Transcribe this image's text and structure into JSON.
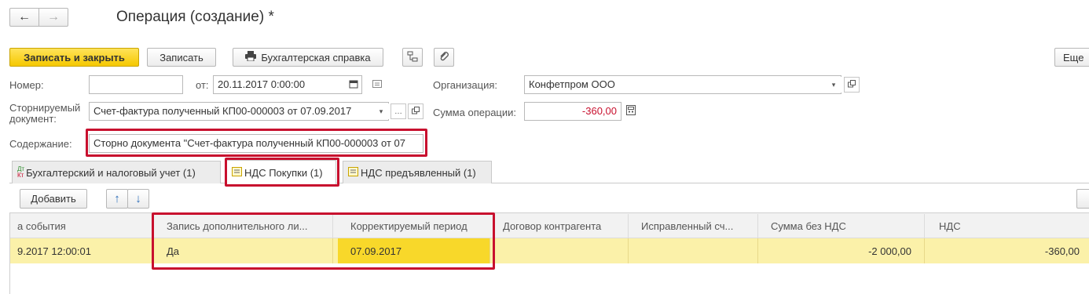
{
  "window": {
    "title": "Операция (создание) *",
    "nav_back": "←",
    "nav_forward": "→"
  },
  "toolbar": {
    "save_close": "Записать и закрыть",
    "save": "Записать",
    "report": "Бухгалтерская справка",
    "more": "Еще"
  },
  "form": {
    "number_label": "Номер:",
    "number_value": "",
    "date_label": "от:",
    "date_value": "20.11.2017  0:00:00",
    "org_label": "Организация:",
    "org_value": "Конфетпром ООО",
    "storno_label_1": "Сторнируемый",
    "storno_label_2": "документ:",
    "storno_value": "Счет-фактура полученный КП00-000003 от 07.09.2017",
    "sum_label": "Сумма операции:",
    "sum_value": "-360,00",
    "content_label": "Содержание:",
    "content_value": "Сторно документа \"Счет-фактура полученный КП00-000003 от 07"
  },
  "tabs": [
    {
      "label": "Бухгалтерский и налоговый учет (1)",
      "icon": "dt-kt-icon"
    },
    {
      "label": "НДС Покупки (1)",
      "icon": "register-icon"
    },
    {
      "label": "НДС предъявленный (1)",
      "icon": "register-icon"
    }
  ],
  "table_toolbar": {
    "add": "Добавить",
    "up": "↑",
    "down": "↓"
  },
  "table": {
    "columns": [
      "а события",
      "Запись дополнительного ли...",
      "Корректируемый период",
      "Договор контрагента",
      "Исправленный сч...",
      "Сумма без НДС",
      "НДС"
    ],
    "rows": [
      [
        "9.2017 12:00:01",
        "Да",
        "07.09.2017",
        "",
        "",
        "-2 000,00",
        "-360,00"
      ]
    ]
  },
  "colors": {
    "accent_yellow": "#f5c800",
    "selected_row": "#fbf1a9",
    "selected_cell": "#f8d82a",
    "highlight_red": "#c8102e"
  }
}
